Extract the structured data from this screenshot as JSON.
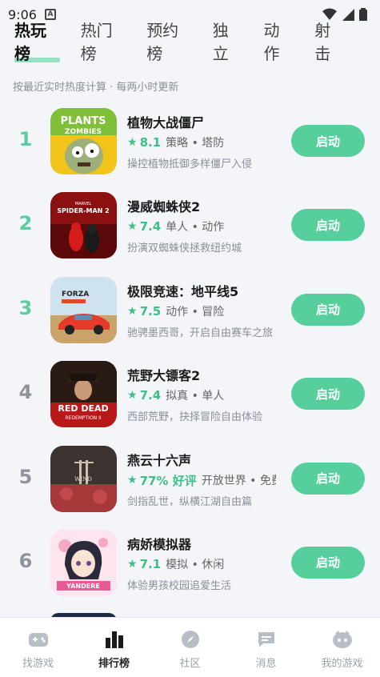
{
  "status_bar": {
    "time": "9:06"
  },
  "tabs": [
    {
      "label": "热玩榜",
      "active": true
    },
    {
      "label": "热门榜",
      "active": false
    },
    {
      "label": "预约榜",
      "active": false
    },
    {
      "label": "独立",
      "active": false
    },
    {
      "label": "动作",
      "active": false
    },
    {
      "label": "射击",
      "active": false
    }
  ],
  "subtitle": "按最近实时热度计算 · 每两小时更新",
  "games": [
    {
      "rank": "1",
      "name": "植物大战僵尸",
      "score": "8.1",
      "tags": "策略 • 塔防",
      "desc": "操控植物抵御多样僵尸入侵",
      "button": "启动",
      "icon": "pvz-zombie-icon"
    },
    {
      "rank": "2",
      "name": "漫威蜘蛛侠2",
      "score": "7.4",
      "tags": "单人 • 动作",
      "desc": "扮演双蜘蛛侠拯救纽约城",
      "button": "启动",
      "icon": "spider-man-icon"
    },
    {
      "rank": "3",
      "name": "极限竞速：地平线5",
      "score": "7.5",
      "tags": "动作 • 冒险",
      "desc": "驰骋墨西哥，开启自由赛车之旅",
      "button": "启动",
      "icon": "forza-car-icon"
    },
    {
      "rank": "4",
      "name": "荒野大镖客2",
      "score": "7.4",
      "tags": "拟真 • 单人",
      "desc": "西部荒野，抉择冒险自由体验",
      "button": "启动",
      "icon": "red-dead-icon"
    },
    {
      "rank": "5",
      "name": "燕云十六声",
      "score": "77% 好评",
      "tags": "开放世界 • 免费",
      "desc": "剑指乱世，纵横江湖自由篇",
      "button": "启动",
      "icon": "where-winds-meet-icon"
    },
    {
      "rank": "6",
      "name": "病娇模拟器",
      "score": "7.1",
      "tags": "模拟 • 休闲",
      "desc": "体验男孩校园追爱生活",
      "button": "启动",
      "icon": "yandere-girl-icon"
    }
  ],
  "bottom_nav": [
    {
      "label": "找游戏",
      "icon": "gamepad-icon",
      "active": false
    },
    {
      "label": "排行榜",
      "icon": "ranking-bars-icon",
      "active": true
    },
    {
      "label": "社区",
      "icon": "compass-icon",
      "active": false
    },
    {
      "label": "消息",
      "icon": "message-icon",
      "active": false
    },
    {
      "label": "我的游戏",
      "icon": "profile-face-icon",
      "active": false
    }
  ],
  "colors": {
    "accent": "#56cf9c",
    "rank_top": "#5ccca0",
    "rank_plain": "#8f949c",
    "background": "#f3f5f9"
  }
}
